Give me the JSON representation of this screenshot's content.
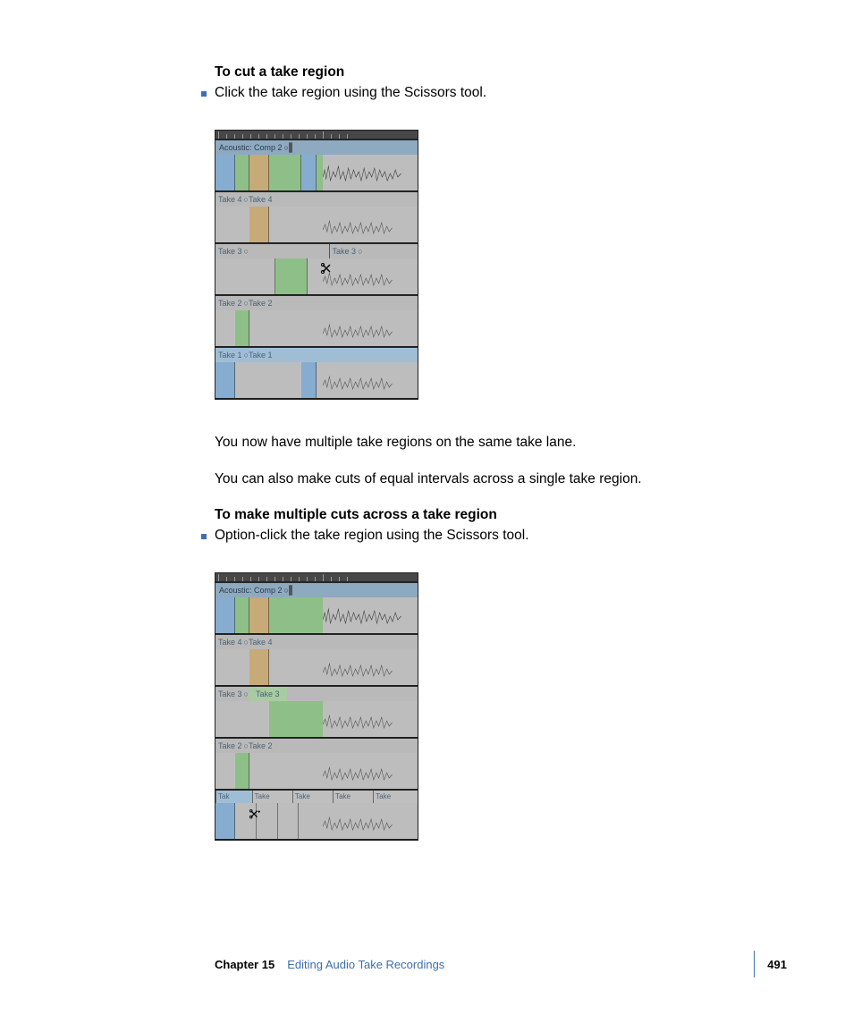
{
  "section1": {
    "heading": "To cut a take region",
    "bullet": "Click the take region using the Scissors tool."
  },
  "para1": "You now have multiple take regions on the same take lane.",
  "para2": "You can also make cuts of equal intervals across a single take region.",
  "section2": {
    "heading": "To make multiple cuts across a take region",
    "bullet": "Option-click the take region using the Scissors tool."
  },
  "fig1": {
    "comp_label": "Acoustic: Comp 2",
    "takes": [
      {
        "left": "Take 4",
        "right": "Take 4"
      },
      {
        "left": "Take 3",
        "right_split": "Take 3"
      },
      {
        "left": "Take 2",
        "right": "Take 2"
      },
      {
        "left": "Take 1",
        "right": "Take 1"
      }
    ]
  },
  "fig2": {
    "comp_label": "Acoustic: Comp 2",
    "takes_top": [
      {
        "left": "Take 4",
        "right": "Take 4"
      },
      {
        "left": "Take 3",
        "right": "Take 3"
      },
      {
        "left": "Take 2",
        "right": "Take 2"
      }
    ],
    "take1_slices": [
      "Tak",
      "Take",
      "Take",
      "Take",
      "Take"
    ]
  },
  "footer": {
    "chapter": "Chapter 15",
    "title": "Editing Audio Take Recordings",
    "page": "491"
  },
  "icons": {
    "circle": "○"
  }
}
